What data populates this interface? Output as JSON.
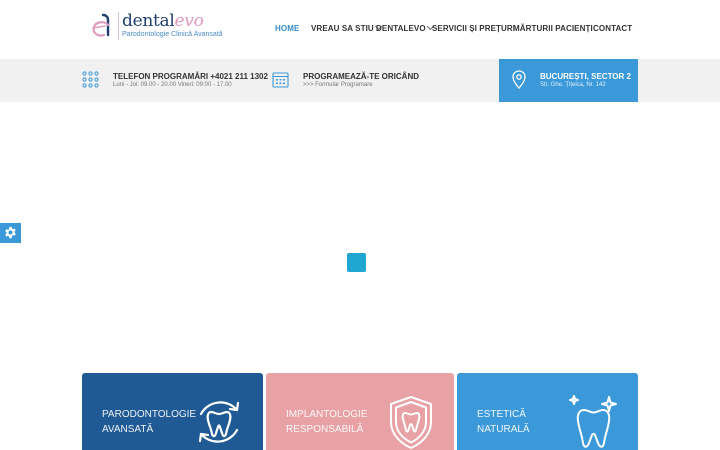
{
  "logo": {
    "name_part1": "dental",
    "name_part2": "evo",
    "tagline": "Parodontologie Clinică Avansată"
  },
  "nav": {
    "items": [
      {
        "label": "HOME",
        "active": true,
        "has_dropdown": false
      },
      {
        "label": "VREAU SA STIU",
        "active": false,
        "has_dropdown": true
      },
      {
        "label": "DENTALEVO",
        "active": false,
        "has_dropdown": true
      },
      {
        "label": "SERVICII ȘI PREȚURI",
        "active": false,
        "has_dropdown": false
      },
      {
        "label": "MĂRTURII PACIENȚI",
        "active": false,
        "has_dropdown": false
      },
      {
        "label": "CONTACT",
        "active": false,
        "has_dropdown": false
      }
    ]
  },
  "infobar": {
    "phone": {
      "title": "TELEFON PROGRAMĂRI +4021 211 1302",
      "sub": "Luni - Joi: 09.00 - 20.00 Vineri: 09:00 - 17.00"
    },
    "booking": {
      "title": "PROGRAMEAZĂ-TE ORICÂND",
      "sub": ">>> Formular Programare"
    },
    "location": {
      "title": "BUCUREȘTI, SECTOR 2",
      "sub": "Str. Ghe. Țițeica, Nr. 142"
    }
  },
  "cards": [
    {
      "line1": "PARODONTOLOGIE",
      "line2": "AVANSATĂ",
      "color": "#1f5a94"
    },
    {
      "line1": "IMPLANTOLOGIE",
      "line2": "RESPONSABILĂ",
      "color": "#e8a2a6"
    },
    {
      "line1": "ESTETICĂ",
      "line2": "NATURALĂ",
      "color": "#3b99da"
    }
  ],
  "colors": {
    "accent": "#3b99da",
    "loader": "#1fa6d1",
    "infobar_bg": "#f1f1f1"
  }
}
